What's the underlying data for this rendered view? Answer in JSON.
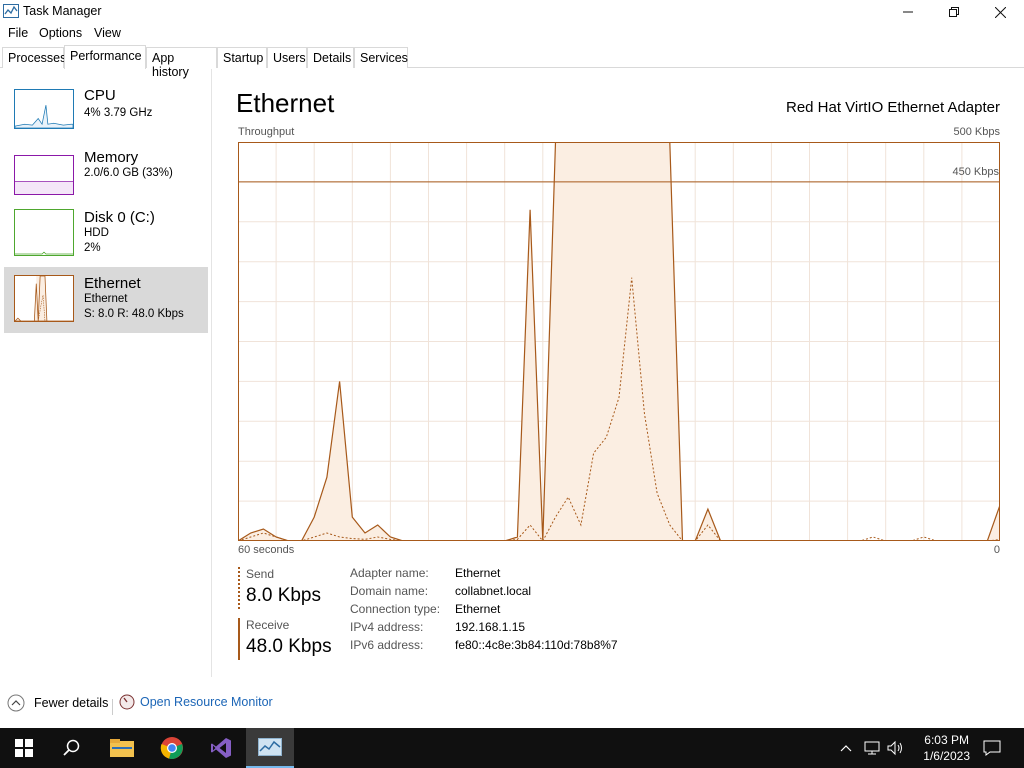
{
  "window": {
    "title": "Task Manager"
  },
  "menu": [
    "File",
    "Options",
    "View"
  ],
  "tabs": [
    "Processes",
    "Performance",
    "App history",
    "Startup",
    "Users",
    "Details",
    "Services"
  ],
  "sidebar": {
    "items": [
      {
        "title": "CPU",
        "line1": "4%  3.79 GHz",
        "line2": ""
      },
      {
        "title": "Memory",
        "line1": "2.0/6.0 GB (33%)",
        "line2": ""
      },
      {
        "title": "Disk 0 (C:)",
        "line1": "HDD",
        "line2": "2%"
      },
      {
        "title": "Ethernet",
        "line1": "Ethernet",
        "line2": "S: 8.0  R: 48.0 Kbps"
      }
    ]
  },
  "main": {
    "heading": "Ethernet",
    "adapter_model": "Red Hat VirtIO Ethernet Adapter",
    "graph_label": "Throughput",
    "max_label": "500 Kbps",
    "ref_label": "450 Kbps",
    "time_label": "60 seconds",
    "zero_label": "0",
    "send_label": "Send",
    "send_value": "8.0 Kbps",
    "receive_label": "Receive",
    "receive_value": "48.0 Kbps",
    "details": [
      {
        "key": "Adapter name:",
        "value": "Ethernet"
      },
      {
        "key": "Domain name:",
        "value": "collabnet.local"
      },
      {
        "key": "Connection type:",
        "value": "Ethernet"
      },
      {
        "key": "IPv4 address:",
        "value": "192.168.1.15"
      },
      {
        "key": "IPv6 address:",
        "value": "fe80::4c8e:3b84:110d:78b8%7"
      }
    ]
  },
  "footer": {
    "fewer_details": "Fewer details",
    "resource_monitor": "Open Resource Monitor"
  },
  "taskbar": {
    "time": "6:03 PM",
    "date": "1/6/2023"
  },
  "chart_data": {
    "type": "area",
    "title": "",
    "xlabel": "60 seconds",
    "ylabel": "Throughput",
    "ylim": [
      0,
      500
    ],
    "reference_line": 450,
    "x": [
      0,
      1,
      2,
      3,
      4,
      5,
      6,
      7,
      8,
      9,
      10,
      11,
      12,
      13,
      14,
      15,
      16,
      17,
      18,
      19,
      20,
      21,
      22,
      23,
      24,
      25,
      26,
      27,
      28,
      29,
      30,
      31,
      32,
      33,
      34,
      35,
      36,
      37,
      38,
      39,
      40,
      41,
      42,
      43,
      44,
      45,
      46,
      47,
      48,
      49,
      50,
      51,
      52,
      53,
      54,
      55,
      56,
      57,
      58,
      59,
      60
    ],
    "series": [
      {
        "kind": "solid",
        "values": [
          0,
          10,
          15,
          5,
          0,
          0,
          30,
          80,
          200,
          30,
          10,
          20,
          5,
          0,
          0,
          0,
          0,
          0,
          0,
          0,
          0,
          0,
          5,
          415,
          0,
          500,
          500,
          500,
          500,
          500,
          500,
          500,
          500,
          500,
          500,
          0,
          0,
          40,
          0,
          0,
          0,
          0,
          0,
          0,
          0,
          0,
          0,
          0,
          0,
          0,
          0,
          0,
          0,
          0,
          0,
          0,
          0,
          0,
          0,
          0,
          45
        ]
      },
      {
        "kind": "dashed",
        "values": [
          0,
          5,
          10,
          5,
          0,
          0,
          5,
          10,
          5,
          3,
          2,
          5,
          2,
          0,
          0,
          0,
          0,
          0,
          0,
          0,
          0,
          0,
          2,
          20,
          0,
          30,
          55,
          20,
          110,
          130,
          180,
          330,
          160,
          60,
          20,
          0,
          0,
          20,
          0,
          0,
          0,
          0,
          0,
          0,
          0,
          0,
          0,
          0,
          0,
          0,
          5,
          0,
          0,
          0,
          5,
          0,
          0,
          0,
          0,
          0,
          2
        ]
      }
    ]
  }
}
